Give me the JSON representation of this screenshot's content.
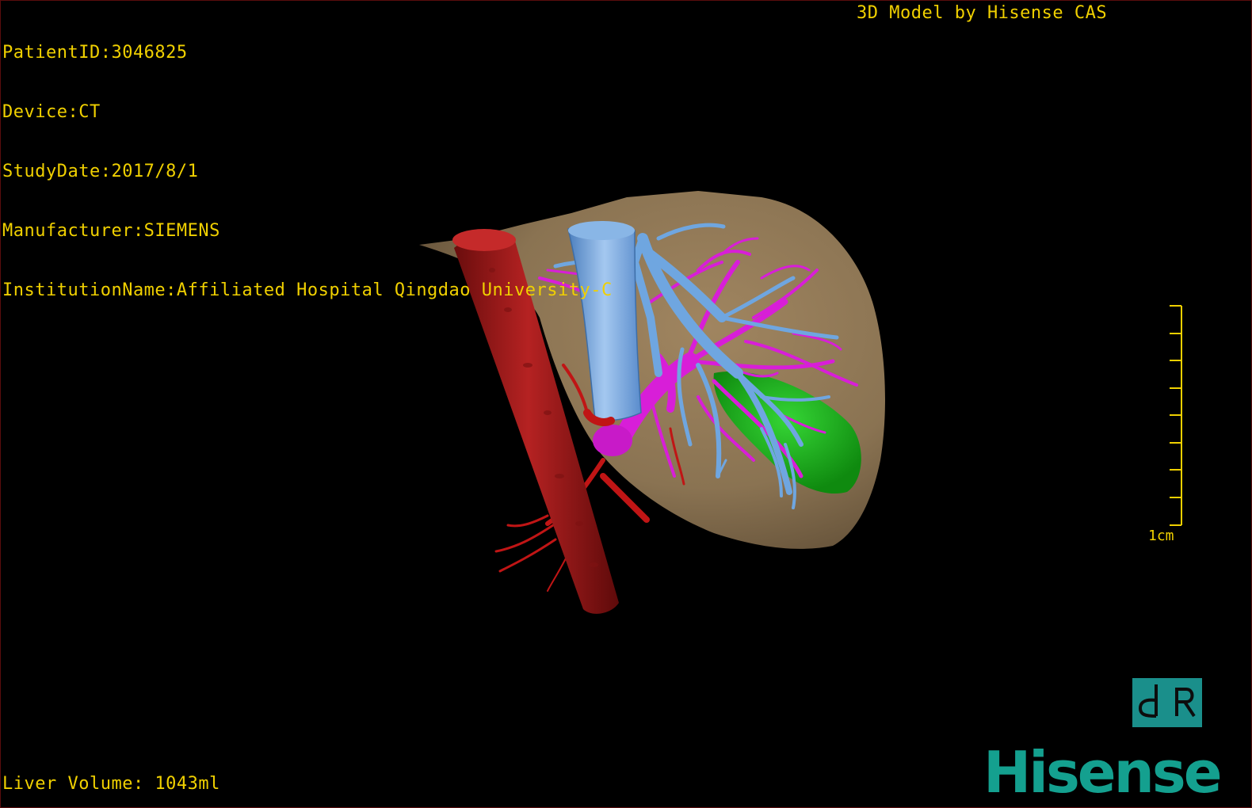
{
  "info": {
    "patient_id": "PatientID:3046825",
    "device": "Device:CT",
    "study_date": "StudyDate:2017/8/1",
    "manufacturer": "Manufacturer:SIEMENS",
    "institution": "InstitutionName:Affiliated Hospital Qingdao University-C"
  },
  "model_credit": "3D Model by Hisense CAS",
  "scale": {
    "label": "1cm"
  },
  "liver_volume": "Liver Volume: 1043ml",
  "logo": {
    "brand": "Hisense",
    "badge": "dR"
  },
  "colors": {
    "overlay_text": "#f0d000",
    "liver": "#8a7352",
    "vena_cava": "#9b1a1a",
    "artery": "#c01515",
    "hepatic_vein": "#6fa6e0",
    "portal_vein": "#d81ed8",
    "lesion": "#18b818",
    "brand": "#14a08f"
  }
}
